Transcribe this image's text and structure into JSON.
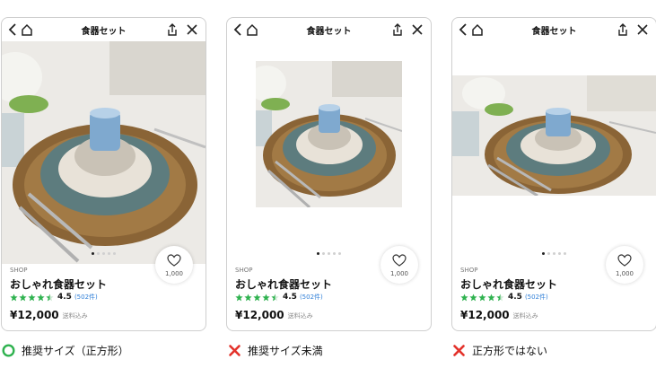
{
  "colors": {
    "star": "#2fb24f",
    "ok": "#2fb24f",
    "ng": "#e3322b",
    "link": "#2f7fd8"
  },
  "cards": [
    {
      "header": {
        "title": "食器セット"
      },
      "dots": [
        true,
        false,
        false,
        false,
        false
      ],
      "like_count": "1,000",
      "shop": "SHOP",
      "product_name": "おしゃれ食器セット",
      "rating": {
        "value": "4.5",
        "count": "(502件)",
        "stars": 4.5
      },
      "price": "¥12,000",
      "shipping": "送料込み",
      "caption": {
        "mark": "circle-icon",
        "text": "推奨サイズ（正方形）"
      }
    },
    {
      "header": {
        "title": "食器セット"
      },
      "dots": [
        true,
        false,
        false,
        false,
        false
      ],
      "like_count": "1,000",
      "shop": "SHOP",
      "product_name": "おしゃれ食器セット",
      "rating": {
        "value": "4.5",
        "count": "(502件)",
        "stars": 4.5
      },
      "price": "¥12,000",
      "shipping": "送料込み",
      "caption": {
        "mark": "cross-icon",
        "text": "推奨サイズ未満"
      }
    },
    {
      "header": {
        "title": "食器セット"
      },
      "dots": [
        true,
        false,
        false,
        false,
        false
      ],
      "like_count": "1,000",
      "shop": "SHOP",
      "product_name": "おしゃれ食器セット",
      "rating": {
        "value": "4.5",
        "count": "(502件)",
        "stars": 4.5
      },
      "price": "¥12,000",
      "shipping": "送料込み",
      "caption": {
        "mark": "cross-icon",
        "text": "正方形ではない"
      }
    }
  ]
}
